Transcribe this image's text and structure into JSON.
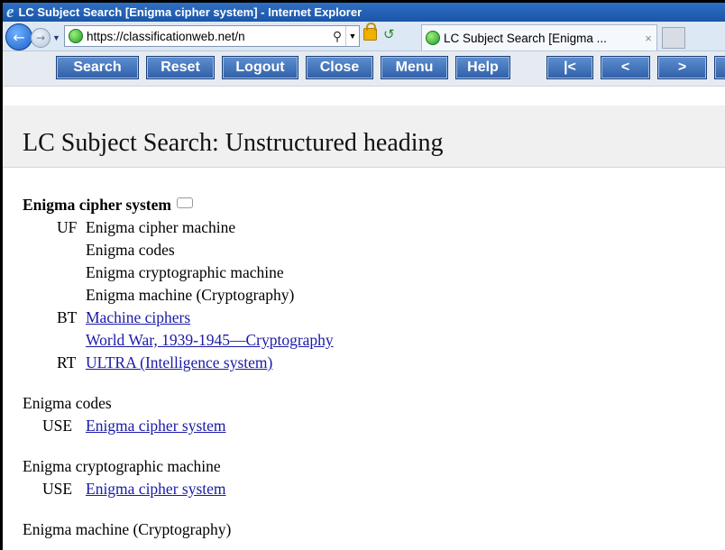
{
  "window": {
    "title": "LC Subject Search [Enigma cipher system] - Internet Explorer",
    "logo_glyph": "e"
  },
  "browser": {
    "url": "https://classificationweb.net/n",
    "tab_label": "LC Subject Search [Enigma ...",
    "search_glyph": "⚲",
    "dropdown_glyph": "▼",
    "close_glyph": "×",
    "back_glyph": "←",
    "forward_glyph": "→",
    "refresh_glyph": "↺"
  },
  "toolbar": {
    "buttons": [
      "Search",
      "Reset",
      "Logout",
      "Close",
      "Menu",
      "Help"
    ],
    "nav_buttons": [
      "|<",
      "<",
      ">"
    ],
    "button_color": "#3b6cb5"
  },
  "page": {
    "title": "LC Subject Search: Unstructured heading"
  },
  "entry": {
    "heading": "Enigma cipher system",
    "uf_tag": "UF",
    "uf_terms": [
      "Enigma cipher machine",
      "Enigma codes",
      "Enigma cryptographic machine",
      "Enigma machine (Cryptography)"
    ],
    "bt_tag": "BT",
    "bt_terms": [
      "Machine ciphers",
      "World War, 1939-1945—Cryptography"
    ],
    "rt_tag": "RT",
    "rt_terms": [
      "ULTRA (Intelligence system)"
    ]
  },
  "see_refs": [
    {
      "term": "Enigma codes",
      "tag": "USE",
      "target": "Enigma cipher system"
    },
    {
      "term": "Enigma cryptographic machine",
      "tag": "USE",
      "target": "Enigma cipher system"
    },
    {
      "term": "Enigma machine (Cryptography)"
    }
  ],
  "colors": {
    "link": "#1a1aa8",
    "title_bar": "#2560b8"
  }
}
